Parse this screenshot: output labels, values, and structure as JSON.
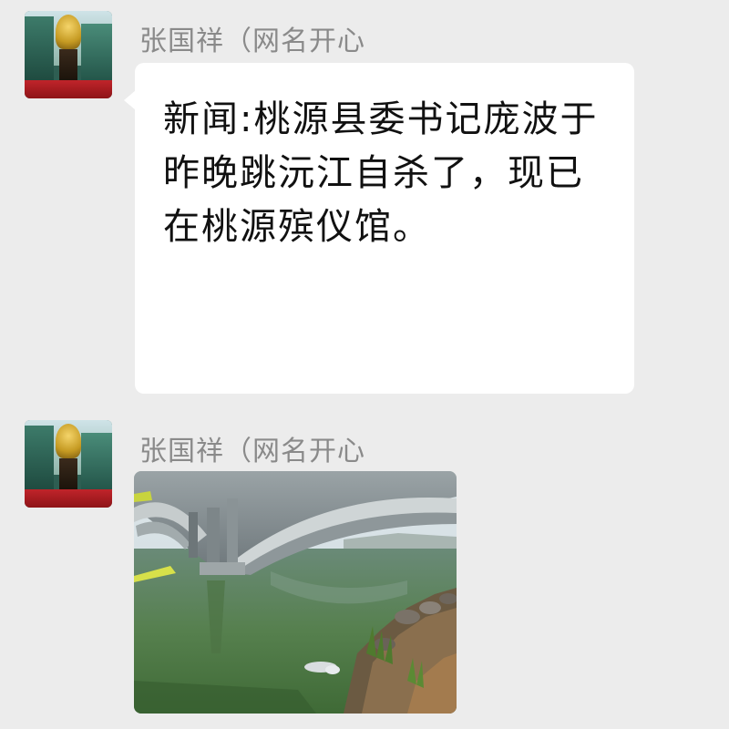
{
  "messages": [
    {
      "sender": "张国祥（网名开心",
      "text": "新闻:桃源县委书记庞波于昨晚跳沅江自杀了，现已在桃源殡仪馆。",
      "avatar_icon": "trophy-avatar"
    },
    {
      "sender": "张国祥（网名开心",
      "image_icon": "bridge-river-photo",
      "avatar_icon": "trophy-avatar"
    }
  ]
}
